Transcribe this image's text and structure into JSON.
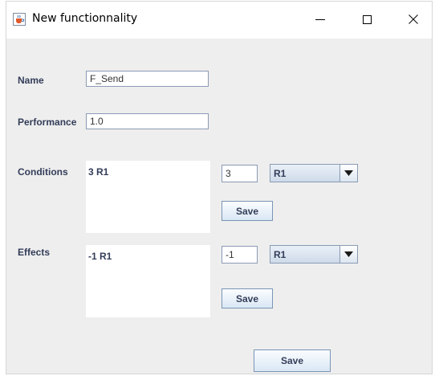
{
  "window": {
    "title": "New functionnality",
    "app_icon": "java-cup-icon",
    "controls": {
      "minimize": "minimize-icon",
      "maximize": "maximize-icon",
      "close": "close-icon"
    }
  },
  "form": {
    "name": {
      "label": "Name",
      "value": "F_Send"
    },
    "performance": {
      "label": "Performance",
      "value": "1.0"
    },
    "conditions": {
      "label": "Conditions",
      "list_text": "3 R1",
      "amount_value": "3",
      "resource_selected": "R1",
      "save_label": "Save"
    },
    "effects": {
      "label": "Effects",
      "list_text": "-1 R1",
      "amount_value": "-1",
      "resource_selected": "R1",
      "save_label": "Save"
    },
    "save_label": "Save"
  }
}
